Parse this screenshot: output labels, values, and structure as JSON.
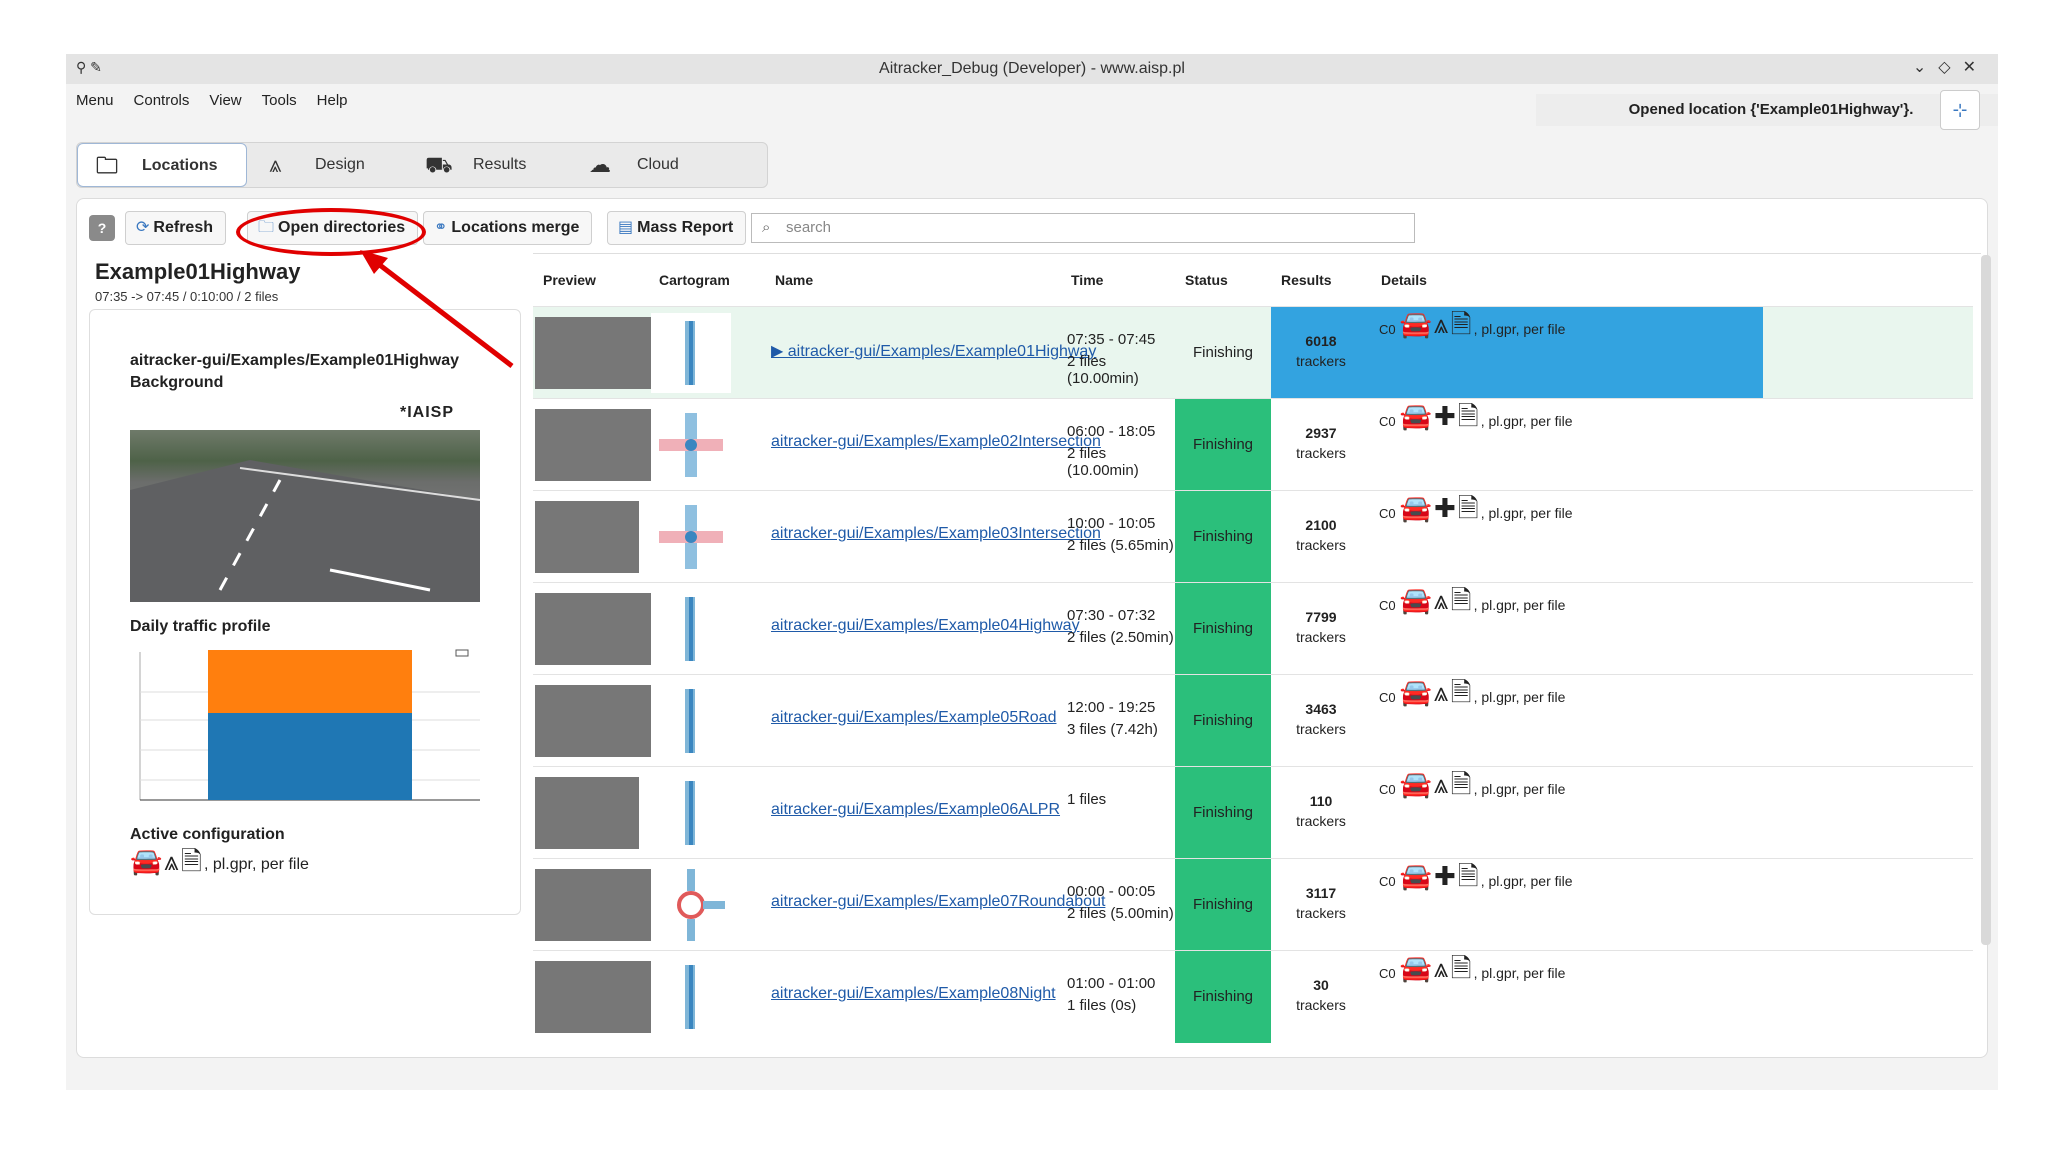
{
  "window": {
    "title": "Aitracker_Debug (Developer) - www.aisp.pl",
    "controls": [
      "⌄",
      "◇",
      "✕"
    ]
  },
  "menubar": [
    "Menu",
    "Controls",
    "View",
    "Tools",
    "Help"
  ],
  "notice": "Opened location {'Example01Highway'}.",
  "tabs": [
    {
      "label": "Locations",
      "icon": "folder-icon",
      "active": true
    },
    {
      "label": "Design",
      "icon": "road-icon",
      "active": false
    },
    {
      "label": "Results",
      "icon": "car-stats-icon",
      "active": false
    },
    {
      "label": "Cloud",
      "icon": "cloud-icon",
      "active": false
    }
  ],
  "toolbar": {
    "help": "?",
    "refresh": "Refresh",
    "open_directories": "Open directories",
    "locations_merge": "Locations merge",
    "mass_report": "Mass Report",
    "search_placeholder": "search"
  },
  "location": {
    "title": "Example01Highway",
    "subtitle": "07:35 -> 07:45 / 0:10:00 / 2 files",
    "path": "aitracker-gui/Examples/Example01Highway",
    "background_label": "Background",
    "logo": "*IAISP",
    "profile_label": "Daily traffic profile",
    "config_label": "Active configuration",
    "config_text": ", pl.gpr, per file"
  },
  "profile_chart": {
    "type": "bar",
    "colors": {
      "lower": "#1f77b4",
      "upper": "#ff7f0e"
    },
    "stack_fraction_lower": 0.58
  },
  "table": {
    "headers": [
      "Preview",
      "Cartogram",
      "Name",
      "Time",
      "Status",
      "Results",
      "Details"
    ],
    "rows": [
      {
        "name": "▶ aitracker-gui/Examples/Example01Highway",
        "time1": "07:35 - 07:45",
        "time2": "2  files (10.00min)",
        "status": "Finishing",
        "count": "6018",
        "unit": "trackers",
        "c0": "C0",
        "details": ", pl.gpr, per file",
        "selected": true
      },
      {
        "name": "aitracker-gui/Examples/Example02Intersection",
        "time1": "06:00 - 18:05",
        "time2": "2  files (10.00min)",
        "status": "Finishing",
        "count": "2937",
        "unit": "trackers",
        "c0": "C0",
        "details": ", pl.gpr, per file",
        "selected": false
      },
      {
        "name": "aitracker-gui/Examples/Example03Intersection",
        "time1": "10:00 - 10:05",
        "time2": "2  files (5.65min)",
        "status": "Finishing",
        "count": "2100",
        "unit": "trackers",
        "c0": "C0",
        "details": ", pl.gpr, per file",
        "selected": false
      },
      {
        "name": "aitracker-gui/Examples/Example04Highway",
        "time1": "07:30 - 07:32",
        "time2": "2  files (2.50min)",
        "status": "Finishing",
        "count": "7799",
        "unit": "trackers",
        "c0": "C0",
        "details": ", pl.gpr, per file",
        "selected": false
      },
      {
        "name": "aitracker-gui/Examples/Example05Road",
        "time1": "12:00 - 19:25",
        "time2": "3  files (7.42h)",
        "status": "Finishing",
        "count": "3463",
        "unit": "trackers",
        "c0": "C0",
        "details": ", pl.gpr, per file",
        "selected": false
      },
      {
        "name": "aitracker-gui/Examples/Example06ALPR",
        "time1": "1  files",
        "time2": "",
        "status": "Finishing",
        "count": "110",
        "unit": "trackers",
        "c0": "C0",
        "details": ", pl.gpr, per file",
        "selected": false
      },
      {
        "name": "aitracker-gui/Examples/Example07Roundabout",
        "time1": "00:00 - 00:05",
        "time2": "2  files (5.00min)",
        "status": "Finishing",
        "count": "3117",
        "unit": "trackers",
        "c0": "C0",
        "details": ", pl.gpr, per file",
        "selected": false
      },
      {
        "name": "aitracker-gui/Examples/Example08Night",
        "time1": "01:00 - 01:00",
        "time2": "1  files (0s)",
        "status": "Finishing",
        "count": "30",
        "unit": "trackers",
        "c0": "C0",
        "details": ", pl.gpr, per file",
        "selected": false
      }
    ]
  }
}
